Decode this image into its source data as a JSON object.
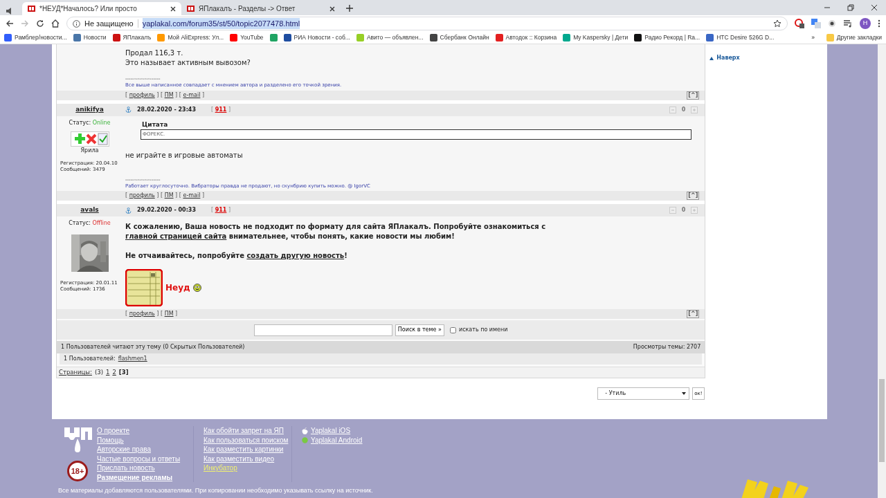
{
  "browser": {
    "tabs": [
      {
        "title": "*НЕУД*Началось? Или просто",
        "selected": true
      },
      {
        "title": "ЯПлакалъ - Разделы -> Ответ",
        "selected": false
      }
    ],
    "address": {
      "security": "Не защищено",
      "url": "yaplakal.com/forum35/st/50/topic2077478.html"
    },
    "profile": "Н",
    "bookmarks": [
      {
        "label": "Рамблер/новости...",
        "color": "#315efb"
      },
      {
        "label": "Новости",
        "color": "#4a76a8"
      },
      {
        "label": "ЯПлакалъ",
        "color": "#cc1111"
      },
      {
        "label": "Мой AliExpress: Ул...",
        "color": "#ff9900"
      },
      {
        "label": "YouTube",
        "color": "#ff0000"
      },
      {
        "color": "#1fa463"
      },
      {
        "label": "РИА Новости - соб...",
        "color": "#1e4da0"
      },
      {
        "label": "Авито — объявлен...",
        "color": "#97cf26"
      },
      {
        "label": "Сбербанк Онлайн",
        "color": "#444444"
      },
      {
        "label": "Автодок :: Корзина",
        "color": "#e32020"
      },
      {
        "label": "My Kaspersky | Дети",
        "color": "#00a88e"
      },
      {
        "label": "Радио Рекорд | Ra...",
        "color": "#111111"
      },
      {
        "label": "HTC Desire 526G D...",
        "color": "#3a67c5"
      }
    ],
    "more": "»",
    "other_bookmarks": "Другие закладки"
  },
  "posts": [
    {
      "kind": "partial",
      "body": [
        {
          "segments": [
            {
              "text": "Продал 116,3 т."
            }
          ]
        },
        {
          "segments": [
            {
              "text": "Это называет активным вывозом?"
            }
          ]
        }
      ],
      "signature": "Все выше написанное совпадает с мнением автора и разделено его точкой зрения.",
      "divider": "--------------------",
      "links": [
        {
          "before": "[ ",
          "label": "профиль",
          "after": " ]"
        },
        {
          "before": " [ ",
          "label": "ПМ",
          "after": " ]"
        },
        {
          "before": " [ ",
          "label": "e-mail",
          "after": " ]"
        }
      ],
      "top_button": "[^]"
    },
    {
      "kind": "ranks",
      "author": "anikifya",
      "status_label": "Статус:",
      "status": "Online",
      "online": true,
      "rank": "Ярила",
      "registration": "Регистрация: 20.04.10",
      "messages": "Сообщений: 3479",
      "date": "28.02.2020 - 23:43",
      "reply": {
        "before": "[ ",
        "label": "911",
        "after": " ]"
      },
      "rating": "0",
      "quote": {
        "title": "Цитата",
        "text": "ФОРЕКС."
      },
      "body": [
        {
          "segments": [
            {
              "text": "не играйте в игровые автоматы"
            }
          ]
        }
      ],
      "signature": "Работает круглосуточно. Вибраторы правда не продают, но скунбрию купить можно. @ IgorVC",
      "divider": "--------------------",
      "links": [
        {
          "before": "[ ",
          "label": "профиль",
          "after": " ]"
        },
        {
          "before": " [ ",
          "label": "ПМ",
          "after": " ]"
        },
        {
          "before": " [ ",
          "label": "e-mail",
          "after": " ]"
        }
      ],
      "top_button": "[^]"
    },
    {
      "author": "avals",
      "status_label": "Статус:",
      "status": "Offline",
      "online": false,
      "registration": "Регистрация: 20.01.11",
      "messages": "Сообщений: 1736",
      "date": "29.02.2020 - 00:33",
      "reply": {
        "before": "[ ",
        "label": "911",
        "after": " ]"
      },
      "rating": "0",
      "bold": true,
      "body": [
        {
          "segments": [
            {
              "text": "К сожалению, Ваша новость не подходит по формату для сайта ЯПлакалъ. Попробуйте ознакомиться с "
            },
            {
              "text": "главной страницей сайта",
              "link": true
            },
            {
              "text": " внимательнее, чтобы понять, какие новости мы любим!"
            }
          ]
        },
        {
          "segments": [
            {
              "text": "Не отчаивайтесь, попробуйте "
            },
            {
              "text": "создать другую новость",
              "link": true
            },
            {
              "text": "!"
            }
          ]
        }
      ],
      "award": {
        "kind": "picture",
        "label": "Неуд"
      },
      "links": [
        {
          "before": "[ ",
          "label": "профиль",
          "after": " ]"
        },
        {
          "before": " [ ",
          "label": "ПМ",
          "after": " ]"
        }
      ],
      "top_button": "[^]"
    }
  ],
  "search": {
    "button": "Поиск в теме »",
    "checkbox_label": "искать по имени",
    "checked": false
  },
  "stats": {
    "readers": "1 Пользователей читают эту тему (0 Скрытых Пользователей)",
    "views": "Просмотры темы: 2707",
    "users_label": "1 Пользователей:",
    "users": [
      "flashmen1"
    ]
  },
  "pages": {
    "label": "Страницы:",
    "count": "(3)",
    "items": [
      {
        "label": "1",
        "selected": false
      },
      {
        "label": "2",
        "selected": false
      },
      {
        "label": "[3]",
        "selected": true
      }
    ]
  },
  "jump": {
    "value": "- Утиль",
    "button": "ок!"
  },
  "to_top": "Наверх",
  "footer": {
    "columns": [
      [
        {
          "label": "О проекте"
        },
        {
          "label": "Помощь"
        },
        {
          "label": "Авторские права"
        },
        {
          "label": "Частые вопросы и ответы"
        },
        {
          "label": "Прислать новость"
        },
        {
          "label": "Размещение рекламы",
          "bold": true
        }
      ],
      [
        {
          "label": "Как обойти запрет на ЯП"
        },
        {
          "label": "Как пользоваться поиском"
        },
        {
          "label": "Как разместить картинки"
        },
        {
          "label": "Как разместить видео"
        },
        {
          "label": "Инкубатор",
          "highlight": true
        }
      ],
      [
        {
          "label": "Yaplakal iOS",
          "kind": "apple"
        },
        {
          "label": "Yaplakal Android",
          "kind": "android"
        }
      ]
    ],
    "age": "18+",
    "note": "Все материалы добавляются пользователями. При копировании необходимо указывать ссылку на источник."
  }
}
